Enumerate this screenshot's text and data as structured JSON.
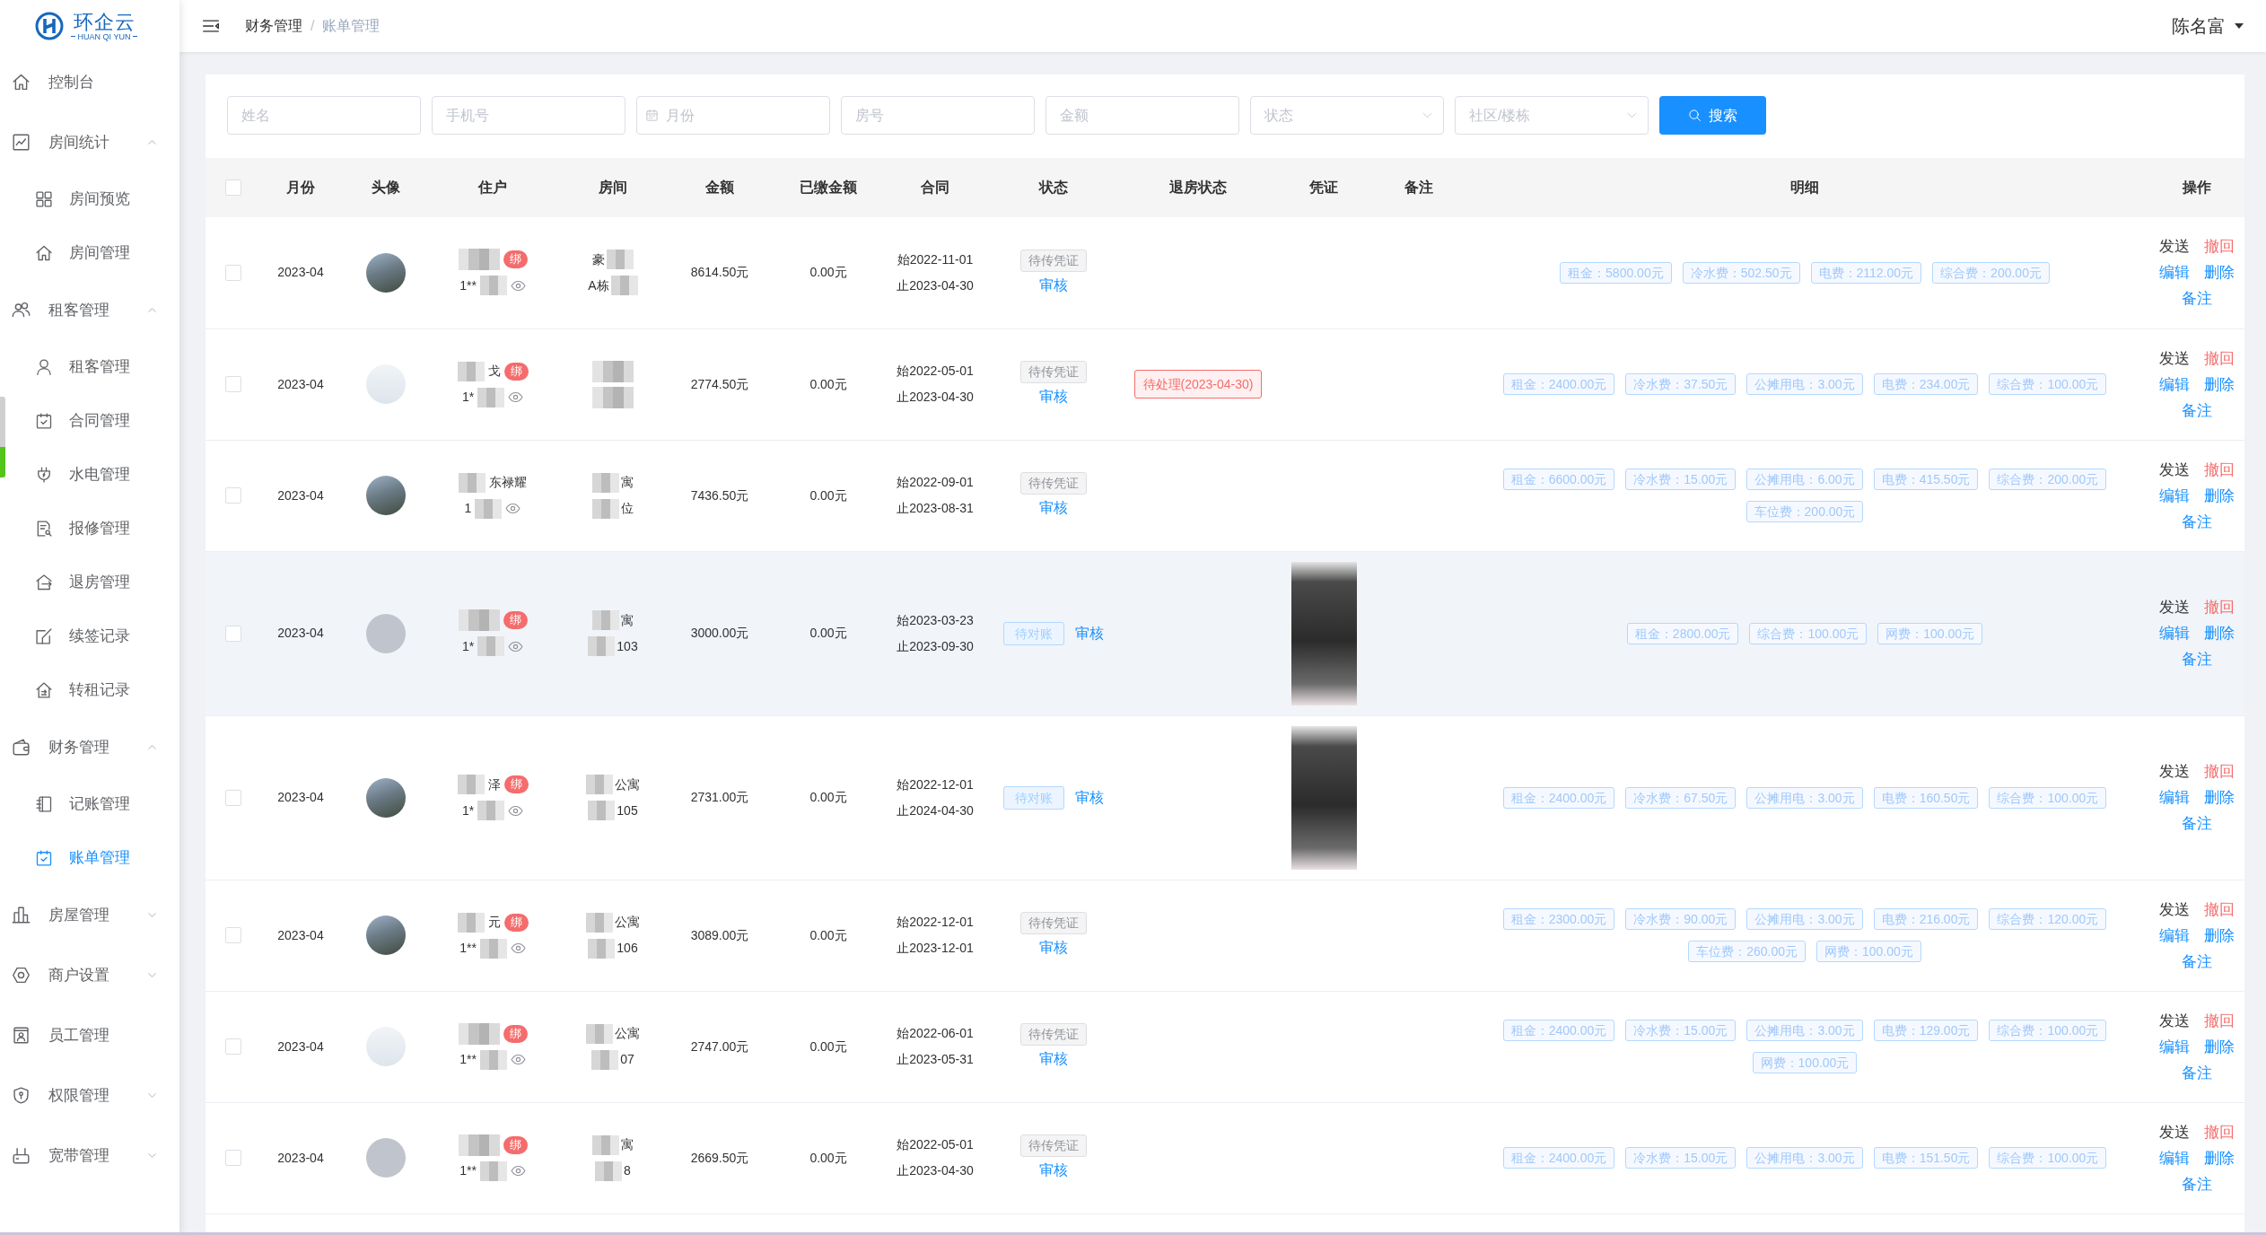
{
  "sidebar": {
    "logo": {
      "name": "环企云",
      "tagline": "HUAN QI YUN"
    },
    "items": [
      {
        "kind": "link",
        "label": "控制台",
        "selected": false
      },
      {
        "kind": "group",
        "label": "房间统计",
        "selected": false,
        "expanded": true,
        "children": [
          {
            "label": "房间预览",
            "selected": false
          },
          {
            "label": "房间管理",
            "selected": false
          }
        ]
      },
      {
        "kind": "group",
        "label": "租客管理",
        "selected": false,
        "expanded": true,
        "children": [
          {
            "label": "租客管理",
            "selected": false
          },
          {
            "label": "合同管理",
            "selected": false
          },
          {
            "label": "水电管理",
            "selected": false
          },
          {
            "label": "报修管理",
            "selected": false
          },
          {
            "label": "退房管理",
            "selected": false
          },
          {
            "label": "续签记录",
            "selected": false
          },
          {
            "label": "转租记录",
            "selected": false
          }
        ]
      },
      {
        "kind": "group",
        "label": "财务管理",
        "selected": false,
        "expanded": true,
        "children": [
          {
            "label": "记账管理",
            "selected": false
          },
          {
            "label": "账单管理",
            "selected": true
          }
        ]
      },
      {
        "kind": "group",
        "label": "房屋管理",
        "selected": false,
        "expanded": false
      },
      {
        "kind": "group",
        "label": "商户设置",
        "selected": false,
        "expanded": false
      },
      {
        "kind": "link",
        "label": "员工管理",
        "selected": false
      },
      {
        "kind": "group",
        "label": "权限管理",
        "selected": false,
        "expanded": false
      },
      {
        "kind": "group",
        "label": "宽带管理",
        "selected": false,
        "expanded": false
      }
    ]
  },
  "header": {
    "breadcrumb": [
      {
        "label": "财务管理",
        "current": false
      },
      {
        "label": "账单管理",
        "current": true
      }
    ],
    "separator": "/",
    "user": "陈名富"
  },
  "filters": [
    {
      "kind": "text",
      "placeholder": "姓名"
    },
    {
      "kind": "text",
      "placeholder": "手机号"
    },
    {
      "kind": "date",
      "placeholder": "月份"
    },
    {
      "kind": "text",
      "placeholder": "房号"
    },
    {
      "kind": "text",
      "placeholder": "金额"
    },
    {
      "kind": "select",
      "placeholder": "状态"
    },
    {
      "kind": "select",
      "placeholder": "社区/楼栋"
    }
  ],
  "search_button": "搜索",
  "table": {
    "select_all": {
      "checked": false
    },
    "columns": [
      "月份",
      "头像",
      "住户",
      "房间",
      "金额",
      "已缴金额",
      "合同",
      "状态",
      "退房状态",
      "凭证",
      "备注",
      "明细",
      "操作"
    ],
    "rows": [
      {
        "checked": false,
        "highlighted": false,
        "month": "2023-04",
        "avatar": {
          "kind": "photo"
        },
        "resident": {
          "name": {
            "kind": "mask"
          },
          "badge": "绑",
          "phone": {
            "kind": "text_mask",
            "text": "1**"
          }
        },
        "room": [
          {
            "kind": "text_mask",
            "text": "豪"
          },
          {
            "kind": "text_mask",
            "text": "A栋"
          }
        ],
        "amount": "8614.50元",
        "paid": "0.00元",
        "contract": {
          "start": "始2022-11-01",
          "end": "止2023-04-30"
        },
        "status": {
          "kind": "pending_voucher",
          "label": "待传凭证",
          "link": "审核"
        },
        "details": [
          "租金：5800.00元",
          "冷水费：502.50元",
          "电费：2112.00元",
          "综合费：200.00元"
        ],
        "actions": [
          {
            "kind": "send",
            "label": "发送"
          },
          {
            "kind": "withdraw",
            "label": "撤回"
          },
          {
            "kind": "edit",
            "label": "编辑"
          },
          {
            "kind": "delete",
            "label": "删除"
          },
          {
            "kind": "note",
            "label": "备注"
          }
        ]
      },
      {
        "checked": false,
        "highlighted": false,
        "month": "2023-04",
        "avatar": {
          "kind": "placeholder"
        },
        "resident": {
          "name": {
            "kind": "mask_text",
            "text": "戈"
          },
          "badge": "绑",
          "phone": {
            "kind": "text_mask",
            "text": "1*"
          }
        },
        "room": [
          {
            "kind": "mask"
          },
          {
            "kind": "mask"
          }
        ],
        "amount": "2774.50元",
        "paid": "0.00元",
        "contract": {
          "start": "始2022-05-01",
          "end": "止2023-04-30"
        },
        "status": {
          "kind": "pending_voucher",
          "label": "待传凭证",
          "link": "审核"
        },
        "checkout": "待处理(2023-04-30)",
        "details": [
          "租金：2400.00元",
          "冷水费：37.50元",
          "公摊用电：3.00元",
          "电费：234.00元",
          "综合费：100.00元"
        ],
        "actions": [
          {
            "kind": "send",
            "label": "发送"
          },
          {
            "kind": "withdraw",
            "label": "撤回"
          },
          {
            "kind": "edit",
            "label": "编辑"
          },
          {
            "kind": "delete",
            "label": "删除"
          },
          {
            "kind": "note",
            "label": "备注"
          }
        ]
      },
      {
        "checked": false,
        "highlighted": false,
        "month": "2023-04",
        "avatar": {
          "kind": "photo"
        },
        "resident": {
          "name": {
            "kind": "mask_text",
            "text": "东禄耀"
          },
          "phone": {
            "kind": "text_mask",
            "text": "1"
          }
        },
        "room": [
          {
            "kind": "mask_text",
            "text": "寓"
          },
          {
            "kind": "mask_text",
            "text": "位"
          }
        ],
        "amount": "7436.50元",
        "paid": "0.00元",
        "contract": {
          "start": "始2022-09-01",
          "end": "止2023-08-31"
        },
        "status": {
          "kind": "pending_voucher",
          "label": "待传凭证",
          "link": "审核"
        },
        "details": [
          "租金：6600.00元",
          "冷水费：15.00元",
          "公摊用电：6.00元",
          "电费：415.50元",
          "综合费：200.00元",
          "车位费：200.00元"
        ],
        "actions": [
          {
            "kind": "send",
            "label": "发送"
          },
          {
            "kind": "withdraw",
            "label": "撤回"
          },
          {
            "kind": "edit",
            "label": "编辑"
          },
          {
            "kind": "delete",
            "label": "删除"
          },
          {
            "kind": "note",
            "label": "备注"
          }
        ]
      },
      {
        "checked": false,
        "highlighted": true,
        "month": "2023-04",
        "avatar": {
          "kind": "blank"
        },
        "resident": {
          "name": {
            "kind": "mask"
          },
          "badge": "绑",
          "phone": {
            "kind": "text_mask",
            "text": "1*"
          }
        },
        "room": [
          {
            "kind": "mask_text",
            "text": "寓"
          },
          {
            "kind": "mask_text",
            "text": "103"
          }
        ],
        "amount": "3000.00元",
        "paid": "0.00元",
        "contract": {
          "start": "始2023-03-23",
          "end": "止2023-09-30"
        },
        "status": {
          "kind": "pending_reconcile",
          "label": "待对账",
          "link": "审核"
        },
        "voucher_image": true,
        "details": [
          "租金：2800.00元",
          "综合费：100.00元",
          "网费：100.00元"
        ],
        "actions": [
          {
            "kind": "send",
            "label": "发送"
          },
          {
            "kind": "withdraw",
            "label": "撤回"
          },
          {
            "kind": "edit",
            "label": "编辑"
          },
          {
            "kind": "delete",
            "label": "删除"
          },
          {
            "kind": "note",
            "label": "备注"
          }
        ]
      },
      {
        "checked": false,
        "highlighted": false,
        "month": "2023-04",
        "avatar": {
          "kind": "photo"
        },
        "resident": {
          "name": {
            "kind": "mask_text",
            "text": "泽"
          },
          "badge": "绑",
          "phone": {
            "kind": "text_mask",
            "text": "1*"
          }
        },
        "room": [
          {
            "kind": "mask_text",
            "text": "公寓"
          },
          {
            "kind": "mask_text",
            "text": "105"
          }
        ],
        "amount": "2731.00元",
        "paid": "0.00元",
        "contract": {
          "start": "始2022-12-01",
          "end": "止2024-04-30"
        },
        "status": {
          "kind": "pending_reconcile",
          "label": "待对账",
          "link": "审核"
        },
        "voucher_image": true,
        "details": [
          "租金：2400.00元",
          "冷水费：67.50元",
          "公摊用电：3.00元",
          "电费：160.50元",
          "综合费：100.00元"
        ],
        "actions": [
          {
            "kind": "send",
            "label": "发送"
          },
          {
            "kind": "withdraw",
            "label": "撤回"
          },
          {
            "kind": "edit",
            "label": "编辑"
          },
          {
            "kind": "delete",
            "label": "删除"
          },
          {
            "kind": "note",
            "label": "备注"
          }
        ]
      },
      {
        "checked": false,
        "highlighted": false,
        "month": "2023-04",
        "avatar": {
          "kind": "photo"
        },
        "resident": {
          "name": {
            "kind": "mask_text",
            "text": "元"
          },
          "badge": "绑",
          "phone": {
            "kind": "text_mask",
            "text": "1**"
          }
        },
        "room": [
          {
            "kind": "mask_text",
            "text": "公寓"
          },
          {
            "kind": "mask_text",
            "text": "106"
          }
        ],
        "amount": "3089.00元",
        "paid": "0.00元",
        "contract": {
          "start": "始2022-12-01",
          "end": "止2023-12-01"
        },
        "status": {
          "kind": "pending_voucher",
          "label": "待传凭证",
          "link": "审核"
        },
        "details": [
          "租金：2300.00元",
          "冷水费：90.00元",
          "公摊用电：3.00元",
          "电费：216.00元",
          "综合费：120.00元",
          "车位费：260.00元",
          "网费：100.00元"
        ],
        "actions": [
          {
            "kind": "send",
            "label": "发送"
          },
          {
            "kind": "withdraw",
            "label": "撤回"
          },
          {
            "kind": "edit",
            "label": "编辑"
          },
          {
            "kind": "delete",
            "label": "删除"
          },
          {
            "kind": "note",
            "label": "备注"
          }
        ]
      },
      {
        "checked": false,
        "highlighted": false,
        "month": "2023-04",
        "avatar": {
          "kind": "placeholder"
        },
        "resident": {
          "name": {
            "kind": "mask"
          },
          "badge": "绑",
          "phone": {
            "kind": "text_mask",
            "text": "1**"
          }
        },
        "room": [
          {
            "kind": "mask_text",
            "text": "公寓"
          },
          {
            "kind": "mask_text",
            "text": "07"
          }
        ],
        "amount": "2747.00元",
        "paid": "0.00元",
        "contract": {
          "start": "始2022-06-01",
          "end": "止2023-05-31"
        },
        "status": {
          "kind": "pending_voucher",
          "label": "待传凭证",
          "link": "审核"
        },
        "details": [
          "租金：2400.00元",
          "冷水费：15.00元",
          "公摊用电：3.00元",
          "电费：129.00元",
          "综合费：100.00元",
          "网费：100.00元"
        ],
        "actions": [
          {
            "kind": "send",
            "label": "发送"
          },
          {
            "kind": "withdraw",
            "label": "撤回"
          },
          {
            "kind": "edit",
            "label": "编辑"
          },
          {
            "kind": "delete",
            "label": "删除"
          },
          {
            "kind": "note",
            "label": "备注"
          }
        ]
      },
      {
        "checked": false,
        "highlighted": false,
        "month": "2023-04",
        "avatar": {
          "kind": "blank"
        },
        "resident": {
          "name": {
            "kind": "mask"
          },
          "badge": "绑",
          "phone": {
            "kind": "text_mask",
            "text": "1**"
          }
        },
        "room": [
          {
            "kind": "mask_text",
            "text": "寓"
          },
          {
            "kind": "mask_text",
            "text": "8"
          }
        ],
        "amount": "2669.50元",
        "paid": "0.00元",
        "contract": {
          "start": "始2022-05-01",
          "end": "止2023-04-30"
        },
        "status": {
          "kind": "pending_voucher",
          "label": "待传凭证",
          "link": "审核"
        },
        "details": [
          "租金：2400.00元",
          "冷水费：15.00元",
          "公摊用电：3.00元",
          "电费：151.50元",
          "综合费：100.00元"
        ],
        "actions": [
          {
            "kind": "send",
            "label": "发送"
          },
          {
            "kind": "withdraw",
            "label": "撤回"
          },
          {
            "kind": "edit",
            "label": "编辑"
          },
          {
            "kind": "delete",
            "label": "删除"
          },
          {
            "kind": "note",
            "label": "备注"
          }
        ]
      }
    ]
  }
}
